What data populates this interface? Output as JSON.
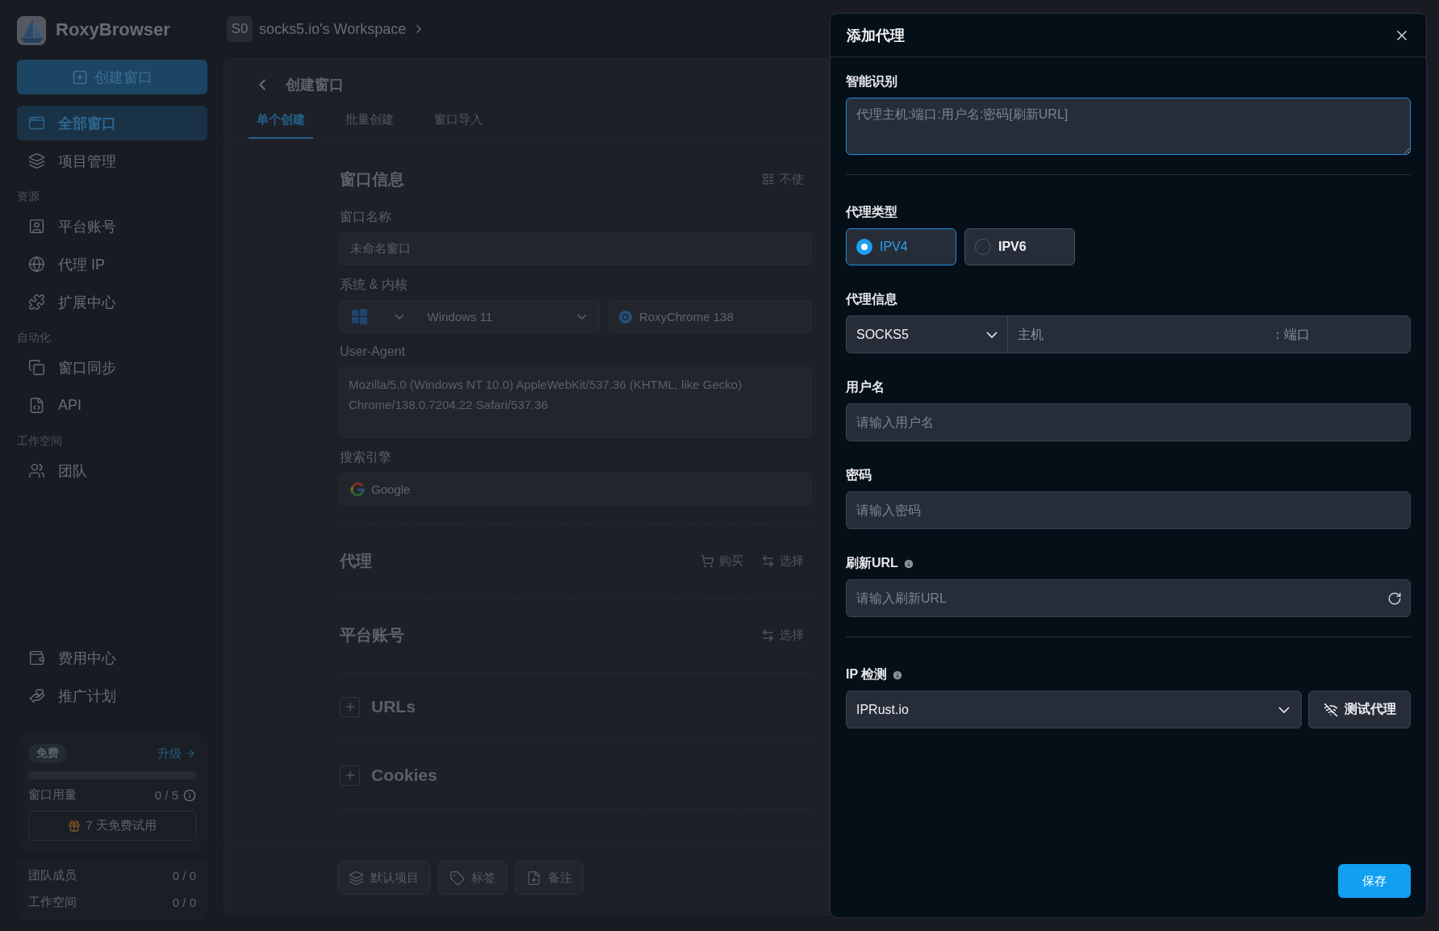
{
  "app": {
    "name": "RoxyBrowser"
  },
  "sidebar": {
    "create_button": "创建窗口",
    "groups": [
      {
        "items": [
          {
            "label": "全部窗口",
            "selected": true
          },
          {
            "label": "项目管理",
            "selected": false
          }
        ]
      },
      {
        "heading": "资源",
        "items": [
          {
            "label": "平台账号",
            "selected": false
          },
          {
            "label": "代理 IP",
            "selected": false
          },
          {
            "label": "扩展中心",
            "selected": false
          }
        ]
      },
      {
        "heading": "自动化",
        "items": [
          {
            "label": "窗口同步",
            "selected": false
          },
          {
            "label": "API",
            "selected": false
          }
        ]
      },
      {
        "heading": "工作空间",
        "items": [
          {
            "label": "团队",
            "selected": false
          }
        ]
      }
    ],
    "bottom_items": [
      {
        "label": "费用中心",
        "selected": false
      },
      {
        "label": "推广计划",
        "selected": false
      }
    ],
    "plan": {
      "badge": "免费",
      "upgrade": "升级",
      "level": 0,
      "usage_label": "窗口用量",
      "usage_value": "0 / 5",
      "trial_button": "7 天免费试用"
    },
    "stats": [
      {
        "label": "团队成员",
        "value": "0 / 0"
      },
      {
        "label": "工作空间",
        "value": "0 / 0"
      }
    ]
  },
  "workspace": {
    "avatar": "S0",
    "name": "socks5.io's Workspace"
  },
  "page": {
    "title": "创建窗口",
    "tabs": [
      {
        "label": "单个创建",
        "selected": true
      },
      {
        "label": "批量创建",
        "selected": false
      },
      {
        "label": "窗口导入",
        "selected": false
      }
    ],
    "window_info": {
      "title": "窗口信息",
      "action": "不使",
      "name_label": "窗口名称",
      "name_placeholder": "未命名窗口",
      "system_label": "系统 & 内核",
      "os": "Windows 11",
      "kernel": "RoxyChrome 138",
      "ua_label": "User-Agent",
      "ua_value": "Mozilla/5.0 (Windows NT 10.0) AppleWebKit/537.36 (KHTML, like Gecko) Chrome/138.0.7204.22 Safari/537.36",
      "search_label": "搜索引擎",
      "search_value": "Google"
    },
    "sections": [
      {
        "title": "代理",
        "kind": "actions",
        "actions": [
          "购买",
          "选择"
        ]
      },
      {
        "title": "平台账号",
        "kind": "actions",
        "actions": [
          "选择"
        ]
      },
      {
        "title": "URLs",
        "kind": "expand"
      },
      {
        "title": "Cookies",
        "kind": "expand"
      }
    ],
    "footer_buttons": [
      "默认项目",
      "标签",
      "备注"
    ]
  },
  "dialog": {
    "title": "添加代理",
    "smart_label": "智能识别",
    "smart_placeholder": "代理主机:端口:用户名:密码[刷新URL]",
    "type_label": "代理类型",
    "types": [
      {
        "label": "IPV4",
        "selected": true
      },
      {
        "label": "IPV6",
        "selected": false
      }
    ],
    "info_label": "代理信息",
    "protocol": "SOCKS5",
    "host_placeholder": "主机",
    "port_placeholder": "：端口",
    "username_label": "用户名",
    "username_placeholder": "请输入用户名",
    "password_label": "密码",
    "password_placeholder": "请输入密码",
    "refresh_label": "刷新URL",
    "refresh_placeholder": "请输入刷新URL",
    "check_label": "IP 检测",
    "check_service": "IPRust.io",
    "test_button": "测试代理",
    "save_button": "保存"
  }
}
